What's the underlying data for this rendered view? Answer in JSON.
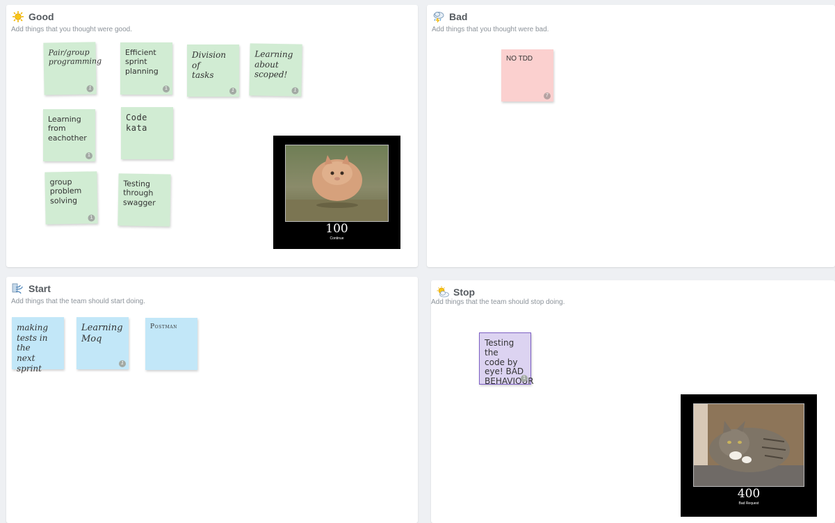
{
  "good": {
    "title": "Good",
    "subtitle": "Add things that you thought were good.",
    "icon": "sun-icon",
    "notes": [
      {
        "text": "Pair/group\nprogramming",
        "votes": "1"
      },
      {
        "text": "Efficient\nsprint\nplanning",
        "votes": "1"
      },
      {
        "text": "Division of\ntasks",
        "votes": "1"
      },
      {
        "text": "Learning\nabout\nscoped!",
        "votes": "1"
      },
      {
        "text": "Learning\nfrom\neachother",
        "votes": "1"
      },
      {
        "text": "Code\nkata",
        "votes": ""
      },
      {
        "text": "group\nproblem\nsolving",
        "votes": "1"
      },
      {
        "text": "Testing\nthrough\nswagger",
        "votes": ""
      }
    ],
    "poster": {
      "code": "100",
      "caption": "Continue"
    }
  },
  "bad": {
    "title": "Bad",
    "subtitle": "Add things that you thought were bad.",
    "icon": "storm-cloud-icon",
    "notes": [
      {
        "text": "NO TDD",
        "votes": "7"
      }
    ]
  },
  "start": {
    "title": "Start",
    "subtitle": "Add things that the team should start doing.",
    "icon": "wind-icon",
    "notes": [
      {
        "text": "making\ntests in the\nnext sprint",
        "votes": ""
      },
      {
        "text": "Learning\nMoq",
        "votes": "1"
      },
      {
        "text": "Postman",
        "votes": ""
      }
    ]
  },
  "stop": {
    "title": "Stop",
    "subtitle": "Add things that the team should stop doing.",
    "icon": "partly-cloudy-icon",
    "notes": [
      {
        "text": "Testing the\ncode by\neye! BAD\nBEHAVIOUR",
        "votes": "1"
      }
    ],
    "poster": {
      "code": "400",
      "caption": "Bad Request"
    }
  },
  "colors": {
    "green_note": "#d1ecd3",
    "red_note": "#fbd0cf",
    "blue_note": "#c2e7f8",
    "purple_note": "#dcd3f1",
    "purple_border": "#7d5fc4"
  }
}
